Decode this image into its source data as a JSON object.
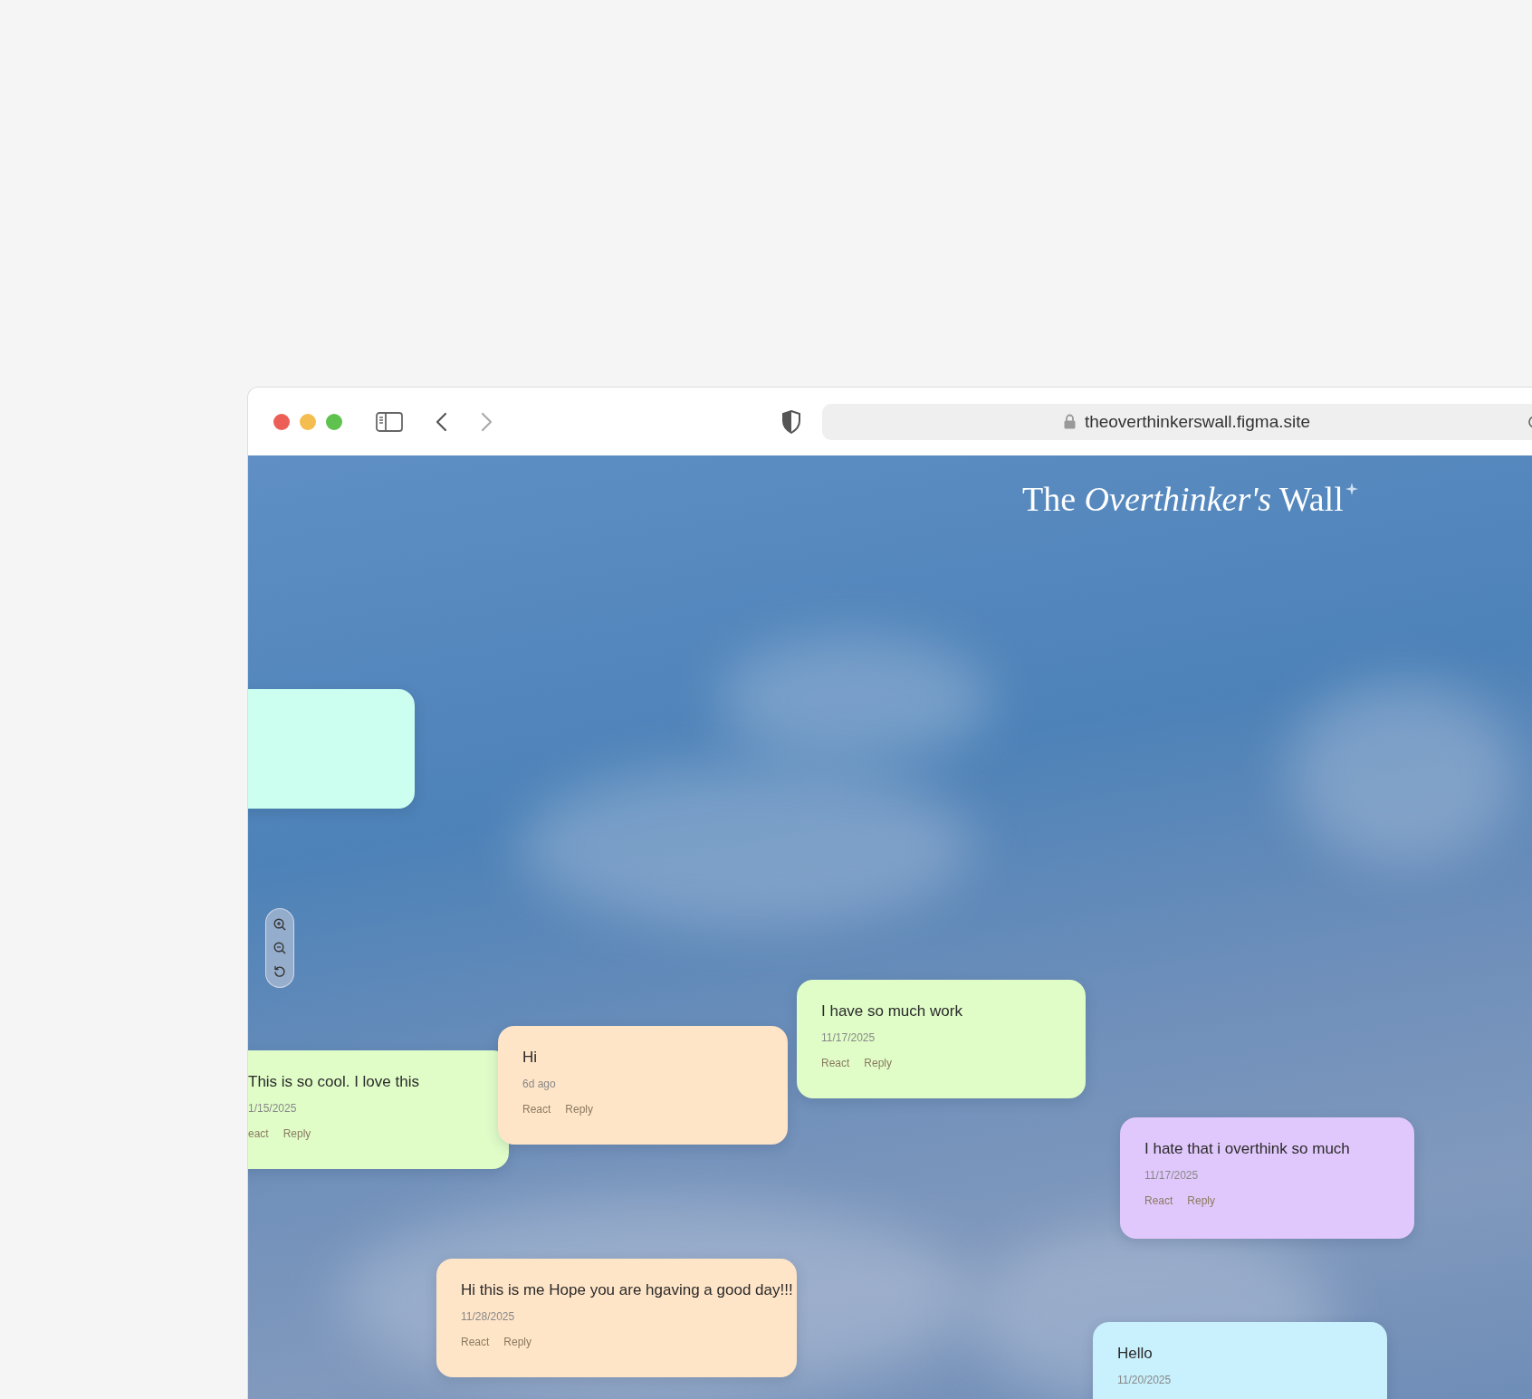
{
  "browser": {
    "url": "theoverthinkerswall.figma.site"
  },
  "wall": {
    "title": "The *Overthinker's* Wall",
    "notes": [
      {
        "color": "#ccfff0"
      },
      {
        "text": "This is so cool. I love this",
        "date": "1/15/2025",
        "actions": [
          "eact",
          "Reply"
        ],
        "color": "#e0fdc8"
      },
      {
        "text": "Hi",
        "date": "6d ago",
        "actions": [
          "React",
          "Reply"
        ],
        "color": "#ffe5c8"
      },
      {
        "text": "I have so much work",
        "date": "11/17/2025",
        "actions": [
          "React",
          "Reply"
        ],
        "color": "#e0fdc8"
      },
      {
        "text": "I hate that i overthink so much",
        "date": "11/17/2025",
        "actions": [
          "React",
          "Reply"
        ],
        "color": "#e1c8fc"
      },
      {
        "text": "Hi this is me Hope you are hgaving a good day!!!",
        "date": "11/28/2025",
        "actions": [
          "React",
          "Reply"
        ],
        "color": "#ffe5c8"
      },
      {
        "text": "Hello",
        "date": "11/20/2025",
        "color": "#c8f0fd"
      }
    ]
  }
}
